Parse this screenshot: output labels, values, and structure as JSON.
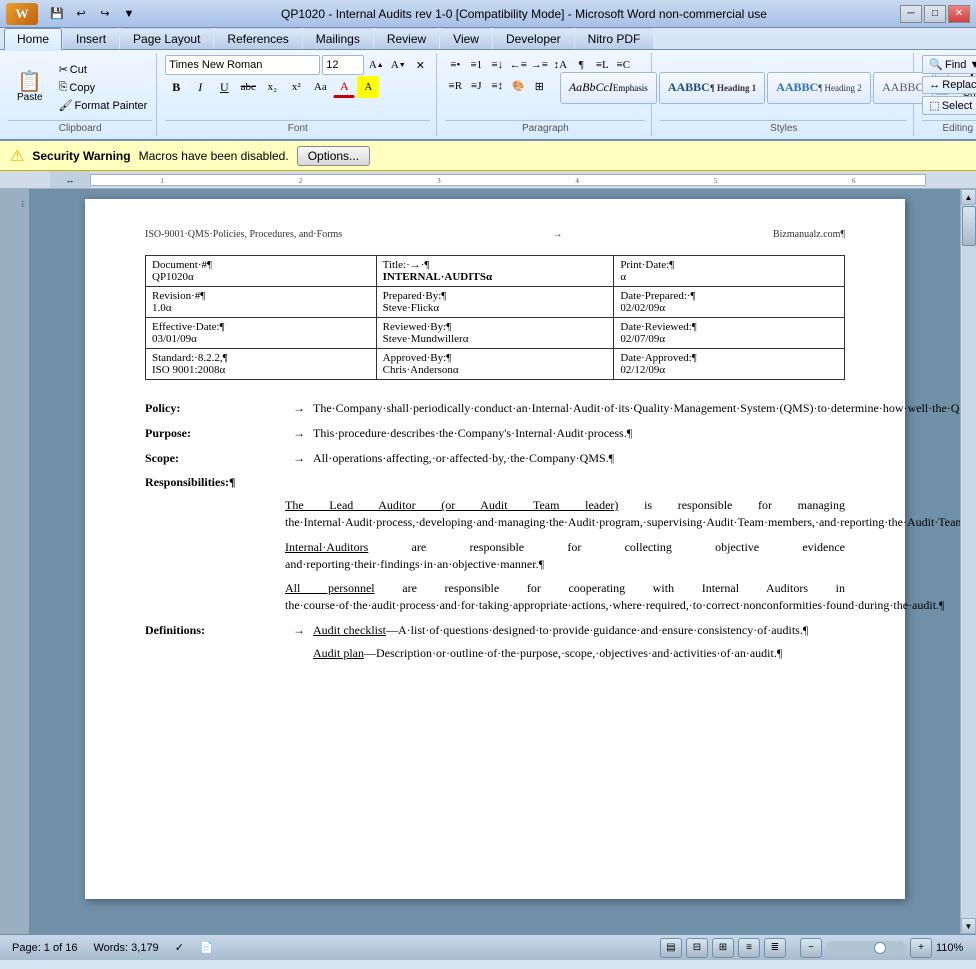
{
  "titleBar": {
    "title": "QP1020 - Internal Audits rev 1-0 [Compatibility Mode] - Microsoft Word non-commercial use",
    "minBtn": "─",
    "maxBtn": "□",
    "closeBtn": "✕"
  },
  "qat": {
    "buttons": [
      "💾",
      "↩",
      "↪",
      "⚡",
      "▼"
    ]
  },
  "ribbon": {
    "tabs": [
      "Home",
      "Insert",
      "Page Layout",
      "References",
      "Mailings",
      "Review",
      "View",
      "Developer",
      "Nitro PDF"
    ],
    "activeTab": "Home",
    "groups": {
      "clipboard": {
        "label": "Clipboard",
        "pasteLabel": "Paste",
        "buttons": [
          "Cut",
          "Copy",
          "Format Painter"
        ]
      },
      "font": {
        "label": "Font",
        "fontName": "Times New Roman",
        "fontSize": "12",
        "growBtn": "A▲",
        "shrinkBtn": "A▼",
        "clearBtn": "✕",
        "boldBtn": "B",
        "italicBtn": "I",
        "underlineBtn": "U",
        "strikeBtn": "abc",
        "subBtn": "x₂",
        "supBtn": "x²",
        "caseBtn": "Aa",
        "colorBtn": "A"
      },
      "paragraph": {
        "label": "Paragraph",
        "buttons": [
          "≡•",
          "≡1",
          "≡↓",
          "≡↑",
          "←¶",
          "≡L",
          "≡C",
          "≡R",
          "≡J",
          "≡↕",
          "¶"
        ]
      },
      "styles": {
        "label": "Styles",
        "items": [
          "Emphasis",
          "Heading 1",
          "Heading 2",
          "AABBC"
        ],
        "changeStylesLabel": "Change\nStyles"
      },
      "editing": {
        "label": "Editing",
        "buttons": [
          "Find ▼",
          "Replace",
          "Select ▼"
        ]
      }
    }
  },
  "securityBar": {
    "warningLabel": "Security Warning",
    "message": "Macros have been disabled.",
    "optionsLabel": "Options..."
  },
  "document": {
    "header": {
      "left": "ISO-9001·QMS·Policies, Procedures, and·Forms",
      "center": "→",
      "right": "Bizmanualz.com¶"
    },
    "table": {
      "rows": [
        {
          "col1Label": "Document·#¶",
          "col1Value": "QP1020α",
          "col2Label": "Title:·→·¶",
          "col2Value": "INTERNAL·AUDITSα",
          "col3Label": "Print·Date:¶",
          "col3Value": "α"
        },
        {
          "col1Label": "Revision·#¶",
          "col1Value": "1.0α",
          "col2Label": "Prepared·By:¶",
          "col2Value": "Steve·Flickα",
          "col3Label": "Date·Prepared:·¶",
          "col3Value": "02/02/09α"
        },
        {
          "col1Label": "Effective·Date:¶",
          "col1Value": "03/01/09α",
          "col2Label": "Reviewed·By:¶",
          "col2Value": "Steve·Mundwillerα",
          "col3Label": "Date·Reviewed:¶",
          "col3Value": "02/07/09α"
        },
        {
          "col1Label": "Standard:·8.2.2,¶",
          "col1Value": "ISO 9001:2008α",
          "col2Label": "Approved·By:¶",
          "col2Value": "Chris·Andersonα",
          "col3Label": "Date·Approved:¶",
          "col3Value": "02/12/09α"
        }
      ]
    },
    "body": {
      "policy": {
        "label": "Policy:",
        "text": "The·Company·shall·periodically·conduct·an·Internal·Audit·of·its·Quality·Management·System·(QMS)·to·determine·how·well·the·QMS·conforms·to·planned·arrangements·and·applicable·requirements and·to·determine·if·it·is·being·effectively·implemented,·maintained,·and·improved·where·possible.¶"
      },
      "purpose": {
        "label": "Purpose:",
        "text": "This·procedure·describes·the·Company's·Internal·Audit·process.¶"
      },
      "scope": {
        "label": "Scope:",
        "text": "All·operations·affecting,·or·affected·by,·the·Company·QMS.¶"
      },
      "responsibilities": {
        "label": "Responsibilities:¶",
        "bullets": [
          {
            "prefix": "The Lead Auditor (or Audit Team leader)",
            "text": " is responsible for managing the·Internal·Audit·process,·developing·and·managing·the·Audit·program,·supervising·Audit·Team·members,·and·reporting·the·Audit·Team's·findings·to·top·management.¶"
          },
          {
            "prefix": "Internal·Auditors",
            "text": " are responsible for collecting objective evidence and·reporting·their·findings·in·an·objective·manner.¶"
          },
          {
            "prefix": "All personnel",
            "text": " are responsible for cooperating with Internal Auditors in the·course·of·the·audit·process·and·for·taking·appropriate·actions,·where·required,·to·correct·nonconformities·found·during·the·audit.¶"
          }
        ]
      },
      "definitions": {
        "label": "Definitions:",
        "items": [
          {
            "prefix": "Audit checklist",
            "text": "—A·list·of·questions·designed·to·provide·guidance·and·ensure·consistency·of·audits.¶"
          },
          {
            "prefix": "Audit plan",
            "text": "—Description·or·outline·of·the·purpose,·scope,·objectives·and·activities·of·an·audit.¶"
          }
        ]
      }
    }
  },
  "statusBar": {
    "page": "Page: 1 of 16",
    "words": "Words: 3,179",
    "zoom": "110%",
    "viewButtons": [
      "▤",
      "≡",
      "⊞",
      "⛶",
      "⊟"
    ]
  }
}
